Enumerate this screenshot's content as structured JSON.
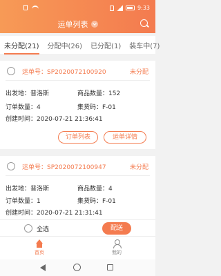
{
  "status_bar": {
    "time": "9:33"
  },
  "header": {
    "title": "运单列表"
  },
  "tabs": [
    {
      "label": "未分配(21)"
    },
    {
      "label": "分配中(26)"
    },
    {
      "label": "已分配(1)"
    },
    {
      "label": "装车中(7)"
    }
  ],
  "orders": [
    {
      "order_no": "运单号：SP2020072100920",
      "status": "未分配",
      "origin": "出发地：普洛斯",
      "goods_qty": "商品数量：152",
      "order_qty": "订单数量：4",
      "set_code": "集货码：F-01",
      "created": "创建时间：2020-07-21 21:36:41",
      "btn_orders": "订单列表",
      "btn_detail": "运单详情"
    },
    {
      "order_no": "运单号：SP2020072100947",
      "status": "未分配",
      "origin": "出发地：普洛斯",
      "goods_qty": "商品数量：4",
      "order_qty": "订单数量：1",
      "set_code": "集货码：F-01",
      "created": "创建时间：2020-07-21 21:31:41"
    }
  ],
  "bottom": {
    "select_all": "全选",
    "dispatch": "配送"
  },
  "tabbar": {
    "home": "首页",
    "me": "我的"
  },
  "colors": {
    "accent": "#f47b4f"
  }
}
